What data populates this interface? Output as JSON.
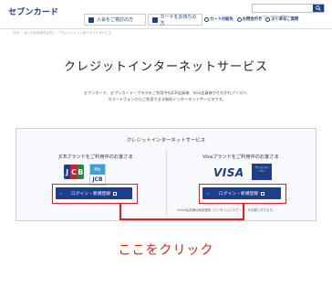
{
  "header": {
    "logo": "セブンカード",
    "search_placeholder": "キーワードから探す",
    "nav_tabs": [
      "入会をご検討の方",
      "カードをお持ちの方"
    ],
    "mini_links": [
      "カードの紛失",
      "お問合わせ",
      "よくあるご質問"
    ]
  },
  "breadcrumb": [
    "TOP",
    "カードをお持ちの方へ",
    "クレジットインターネットサービス"
  ],
  "page": {
    "title": "クレジットインターネットサービス",
    "lead_line1": "セブンカード、セブンカード・プラスをご利用中のJCB会員様、Visa会員様がそれぞれパソコン、",
    "lead_line2": "スマートフォンからご利用できる無料インターネットサービスです。"
  },
  "panel": {
    "title": "クレジットインターネットサービス",
    "left_heading": "JCBブランドをご利用中のお客さま",
    "right_heading": "Visaブランドをご利用中のお客さま",
    "login_label": "ログイン・新規登録",
    "note": "※Visa会員様は事前登録（ワンタイムパスワード）が必要となります。",
    "jcb_logo": "JCB",
    "mycard_label": "My",
    "mycard_sub": "JCB",
    "visa_logo": "VISA",
    "visa_card_top": "クレジット",
    "visa_card_mid": "VISA",
    "visa_card_tag": "VISA"
  },
  "callout": "ここをクリック",
  "colors": {
    "brand": "#1b3f8c",
    "highlight": "#e61e1e"
  }
}
